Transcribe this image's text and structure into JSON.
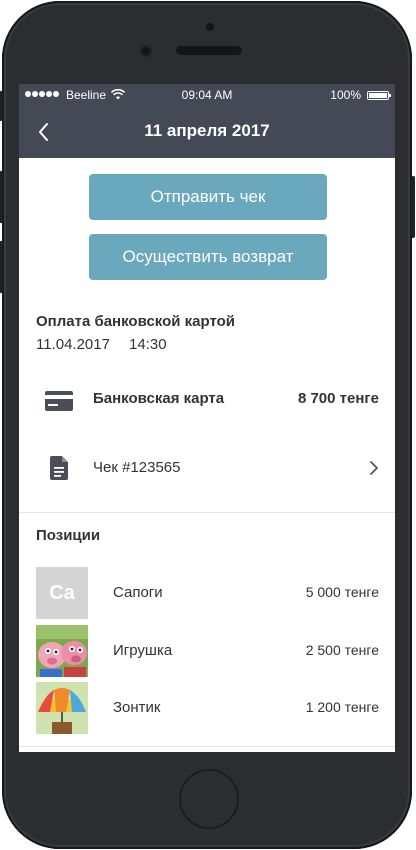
{
  "statusbar": {
    "carrier": "Beeline",
    "time": "09:04 AM",
    "battery": "100%"
  },
  "navbar": {
    "title": "11 апреля 2017"
  },
  "actions": {
    "send_receipt": "Отправить чек",
    "refund": "Осуществить возврат"
  },
  "payment": {
    "title": "Оплата банковской картой",
    "date": "11.04.2017",
    "time": "14:30",
    "card_label": "Банковская карта",
    "amount": "8 700 тенге",
    "receipt": "Чек #123565"
  },
  "positions": {
    "title": "Позиции",
    "items": [
      {
        "thumb_text": "Ca",
        "name": "Сапоги",
        "price": "5 000 тенге"
      },
      {
        "name": "Игрушка",
        "price": "2 500 тенге"
      },
      {
        "name": "Зонтик",
        "price": "1 200 тенге"
      }
    ]
  },
  "colors": {
    "header": "#434a55",
    "button": "#6aa9bd",
    "device": "#2c2d31"
  }
}
